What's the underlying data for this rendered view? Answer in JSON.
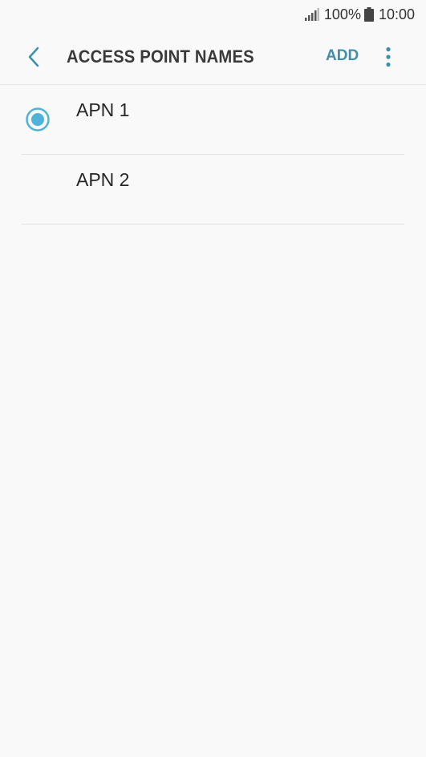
{
  "status_bar": {
    "battery_level": "100%",
    "time": "10:00"
  },
  "header": {
    "title": "ACCESS POINT NAMES",
    "add_label": "ADD"
  },
  "apns": [
    {
      "label": "APN 1",
      "selected": true
    },
    {
      "label": "APN 2",
      "selected": false
    }
  ],
  "colors": {
    "accent": "#4fb3d9",
    "accent_text": "#3d8fb0",
    "background": "#f9f9f9"
  },
  "icons": {
    "back": "chevron-left-icon",
    "more": "more-vertical-icon",
    "signal": "signal-icon",
    "battery": "battery-icon"
  }
}
